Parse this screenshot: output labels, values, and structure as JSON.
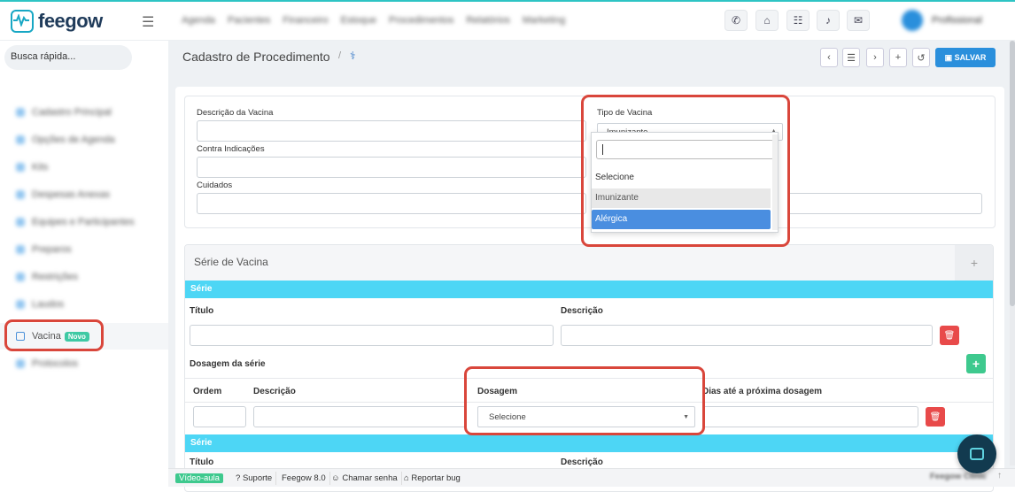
{
  "app": {
    "logo_text": "feegow"
  },
  "topnav": [
    "Agenda",
    "Pacientes",
    "Financeiro",
    "Estoque",
    "Procedimentos",
    "Relatórios",
    "Marketing"
  ],
  "user": {
    "name": "Profissional"
  },
  "sidebar": {
    "search_placeholder": "Busca rápida...",
    "items": [
      {
        "label": "Cadastro Principal",
        "blurred": true
      },
      {
        "label": "Opções de Agenda",
        "blurred": true
      },
      {
        "label": "Kits",
        "blurred": true
      },
      {
        "label": "Despesas Anexas",
        "blurred": true
      },
      {
        "label": "Equipes e Participantes",
        "blurred": true
      },
      {
        "label": "Preparos",
        "blurred": true
      },
      {
        "label": "Restrições",
        "blurred": true
      },
      {
        "label": "Laudos",
        "blurred": true
      },
      {
        "label": "Vacina",
        "badge": "Novo",
        "active": true
      },
      {
        "label": "Protocolos",
        "blurred": true
      }
    ]
  },
  "page": {
    "title": "Cadastro de Procedimento",
    "separator": "/",
    "save_label": "SALVAR"
  },
  "form": {
    "descricao_label": "Descrição da Vacina",
    "contra_label": "Contra Indicações",
    "cuidados_label": "Cuidados",
    "tipo_label": "Tipo de Vacina",
    "tipo_value": "Imunizante",
    "tipo_options": [
      "Selecione",
      "Imunizante",
      "Alérgica"
    ]
  },
  "serie": {
    "section_title": "Série de Vacina",
    "bar_label": "Série",
    "titulo_label": "Título",
    "descricao_label": "Descrição",
    "dosagem_serie_label": "Dosagem da série",
    "col_ordem": "Ordem",
    "col_descricao": "Descrição",
    "col_dosagem": "Dosagem",
    "col_dias": "Dias até a próxima dosagem",
    "dosagem_value": "Selecione",
    "bar2_label": "Série",
    "titulo2_label": "Título",
    "descricao2_label": "Descrição"
  },
  "footer": {
    "video": "Vídeo-aula",
    "suporte": "Suporte",
    "version": "Feegow 8.0",
    "chamar": "Chamar senha",
    "bug": "Reportar bug",
    "brand": "Feegow Clinic"
  }
}
